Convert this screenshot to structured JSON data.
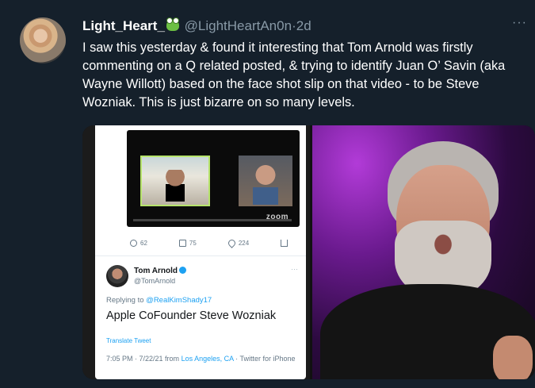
{
  "tweet": {
    "display_name": "Light_Heart_",
    "emoji_icon": "frog-icon",
    "handle": "@LightHeartAn0n",
    "dot": "·",
    "time": "2d",
    "more": "···",
    "text": "I saw this yesterday & found it interesting that Tom Arnold was firstly commenting on a Q related posted, & trying to identify Juan O’ Savin (aka Wayne Willott) based on the face shot slip on that video - to be Steve Wozniak.  This is just bizarre on so many levels."
  },
  "embedded": {
    "zoom_label": "zoom",
    "counts": {
      "replies": "62",
      "retweets": "75",
      "likes": "224"
    },
    "author_name": "Tom Arnold",
    "author_handle": "@TomArnold",
    "more": "···",
    "replying_prefix": "Replying to",
    "replying_to": "@RealKimShady17",
    "text": "Apple CoFounder Steve Wozniak",
    "translate": "Translate Tweet",
    "timestamp": "7:05 PM · 7/22/21 from",
    "location": "Los Angeles, CA",
    "source": "· Twitter for iPhone"
  },
  "colors": {
    "background": "#15202b",
    "secondary": "#8899a6",
    "accent": "#1da1f2"
  }
}
